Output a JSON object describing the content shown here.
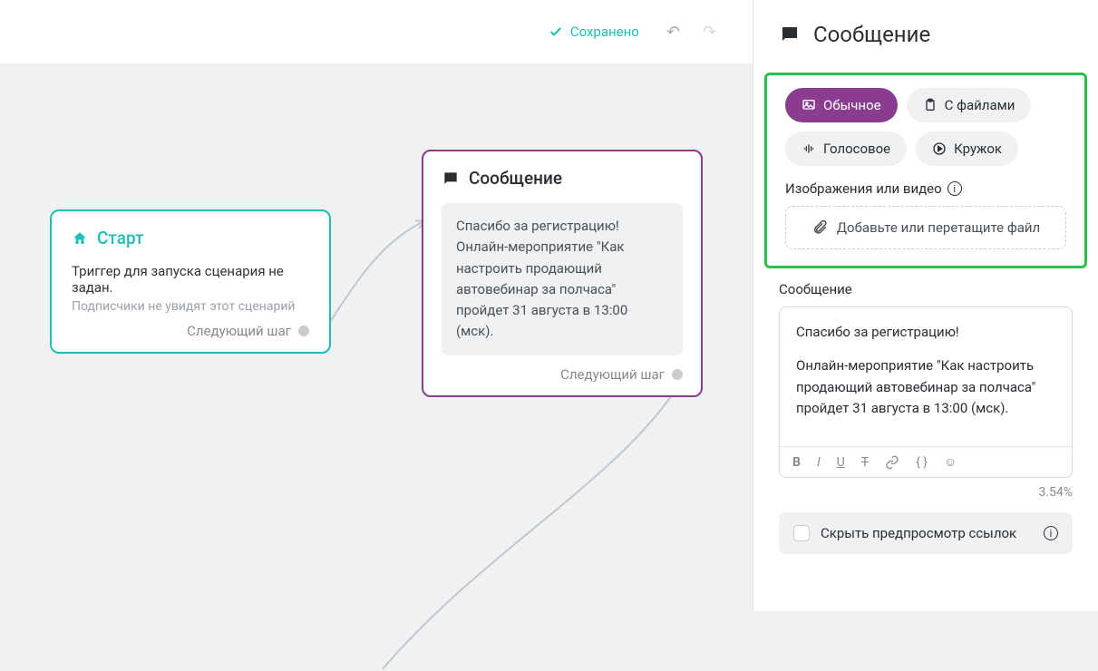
{
  "topbar": {
    "saved_label": "Сохранено"
  },
  "canvas": {
    "start": {
      "title": "Старт",
      "line1": "Триггер для запуска сценария не задан.",
      "line2": "Подписчики не увидят этот сценарий",
      "next": "Следующий шаг"
    },
    "message": {
      "title": "Сообщение",
      "body": "Спасибо за регистрацию! Онлайн-мероприятие \"Как настроить продающий автовебинар за полчаса\" пройдет 31 августа в 13:00 (мск).",
      "next": "Следующий шаг"
    }
  },
  "sidebar": {
    "title": "Сообщение",
    "tabs": {
      "regular": "Обычное",
      "files": "С файлами",
      "voice": "Голосовое",
      "circle": "Кружок"
    },
    "media_label": "Изображения или видео",
    "dropzone": "Добавьте или перетащите файл",
    "message_label": "Сообщение",
    "editor": {
      "p1": "Спасибо за регистрацию!",
      "p2": "Онлайн-мероприятие \"Как настроить продающий автовебинар за полчаса\" пройдет 31 августа в 13:00 (мск)."
    },
    "percent": "3.54%",
    "hide_preview": "Скрыть предпросмотр ссылок"
  },
  "icons": {
    "home": "home-icon",
    "chat": "chat-icon",
    "image": "image-icon",
    "clipboard": "clipboard-icon",
    "audio": "audio-icon",
    "play": "play-icon",
    "attach": "attach-icon",
    "info": "info-icon"
  }
}
